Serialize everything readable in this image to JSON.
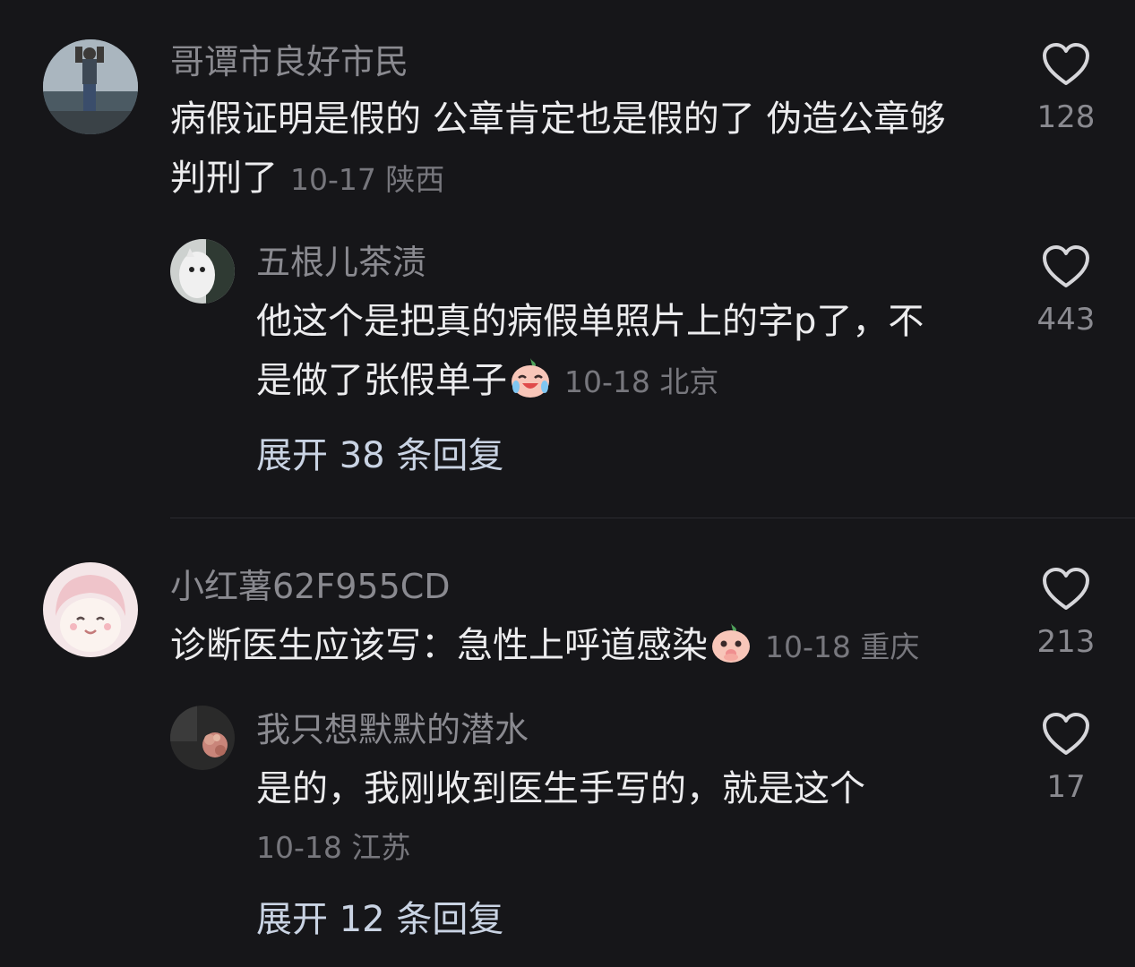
{
  "comments": [
    {
      "username": "哥谭市良好市民",
      "line1": "病假证明是假的 公章肯定也是假的了 伪造公章够",
      "line2": "判刑了",
      "date": "10-17",
      "location": "陕西",
      "likes": "128",
      "reply": {
        "username": "五根儿茶渍",
        "line1": "他这个是把真的病假单照片上的字p了，不",
        "line2": "是做了张假单子",
        "emoji": "crying-laughing-emoji",
        "date": "10-18",
        "location": "北京",
        "likes": "443"
      },
      "expand_prefix": "展开",
      "expand_count": "38",
      "expand_suffix": "条回复"
    },
    {
      "username": "小红薯62F955CD",
      "text": "诊断医生应该写：急性上呼道感染",
      "emoji": "shy-emoji",
      "date": "10-18",
      "location": "重庆",
      "likes": "213",
      "reply": {
        "username": "我只想默默的潜水",
        "text": "是的，我刚收到医生手写的，就是这个",
        "date": "10-18",
        "location": "江苏",
        "likes": "17"
      },
      "expand_prefix": "展开",
      "expand_count": "12",
      "expand_suffix": "条回复"
    }
  ],
  "colors": {
    "background": "#161619",
    "text_primary": "#ececee",
    "text_secondary": "#8a8a90",
    "meta": "#77777d",
    "expand": "#c9d3e3"
  }
}
